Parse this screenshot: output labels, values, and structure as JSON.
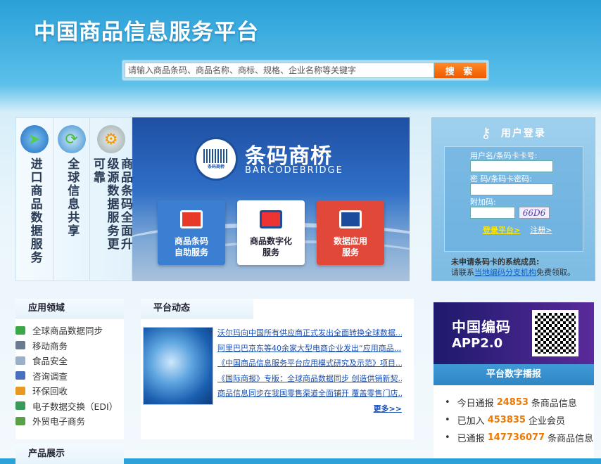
{
  "header": {
    "site_title": "中国商品信息服务平台"
  },
  "search": {
    "placeholder": "请输入商品条码、商品名称、商标、规格、企业名称等关键字",
    "button": "搜 索"
  },
  "categories": [
    {
      "label": "进口商品数据服务",
      "icon": "import-globe-icon"
    },
    {
      "label": "全球信息共享",
      "icon": "global-share-icon"
    },
    {
      "label": "商品条码全面升级源数据服务更可靠",
      "icon": "barcode-upgrade-icon"
    }
  ],
  "banner": {
    "logo_badge": "条码商桥",
    "brand_cn": "条码商桥",
    "brand_en": "BARCODEBRIDGE",
    "tiles": [
      {
        "label_1": "商品条码",
        "label_2": "自助服务"
      },
      {
        "label_1": "商品数字化",
        "label_2": "服务"
      },
      {
        "label_1": "数据应用",
        "label_2": "服务"
      }
    ]
  },
  "login": {
    "title": "用户登录",
    "username_label": "用户名/条码卡卡号:",
    "password_label": "密 码/条码卡密码:",
    "captcha_label": "附加码:",
    "captcha_text": "66D6",
    "login_link": "登录平台>",
    "register_link": "注册>",
    "note_line1": "未申请条码卡的系统成员:",
    "note_prefix": "请联系",
    "note_link": "当地编码分支机构",
    "note_suffix": "免费领取。"
  },
  "fields": {
    "title": "应用领域",
    "items": [
      {
        "label": "全球商品数据同步",
        "color": "#3aa847"
      },
      {
        "label": "移动商务",
        "color": "#6a7a90"
      },
      {
        "label": "食品安全",
        "color": "#9ab0c8"
      },
      {
        "label": "咨询调查",
        "color": "#4a6fc0"
      },
      {
        "label": "环保回收",
        "color": "#e89a20"
      },
      {
        "label": "电子数据交换（EDI）",
        "color": "#3a9a5a"
      },
      {
        "label": "外贸电子商务",
        "color": "#5aa04a"
      }
    ]
  },
  "news": {
    "title": "平台动态",
    "items": [
      "沃尔玛向中国所有供应商正式发出全面转换全球数据...",
      "阿里巴巴京东等40余家大型电商企业发出“应用商品...",
      "《中国商品信息服务平台应用模式研究及示范》项目...",
      "《国际商报》专版：全球商品数据同步 创造供销新契...",
      "商品信息同步在我国零售渠道全面铺开 覆盖零售门店..."
    ],
    "more": "更多>>"
  },
  "products": {
    "title": "产品展示"
  },
  "app": {
    "line1": "中国编码",
    "line2": "APP2.0"
  },
  "stats": {
    "title": "平台数字播报",
    "items": [
      {
        "prefix": "今日通报",
        "value": "24853",
        "suffix": "条商品信息"
      },
      {
        "prefix": "已加入",
        "value": "453835",
        "suffix": "企业会员"
      },
      {
        "prefix": "已通报",
        "value": "147736077",
        "suffix": "条商品信息"
      }
    ]
  }
}
